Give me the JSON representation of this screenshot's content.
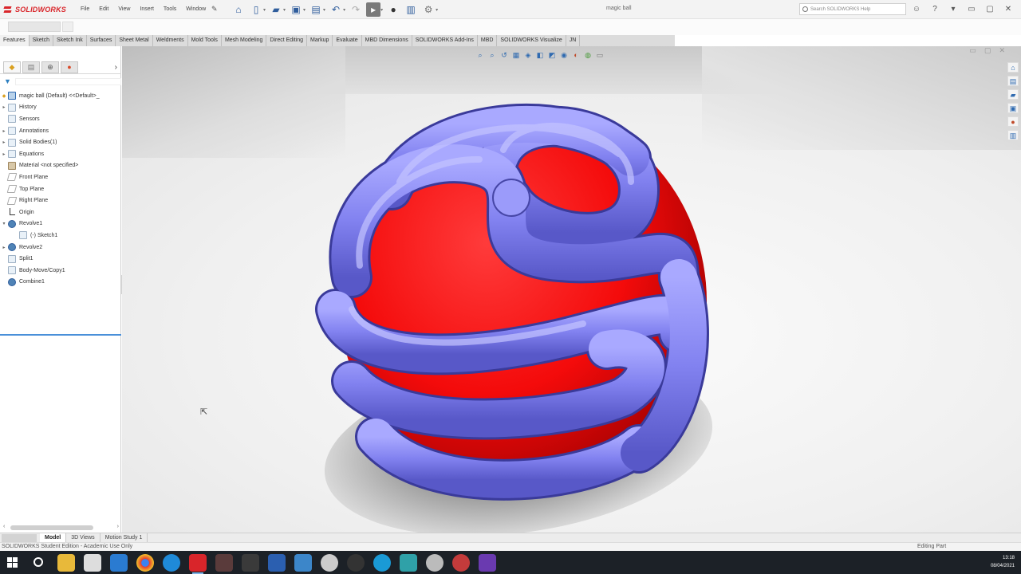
{
  "app": {
    "brand": "SOLIDWORKS",
    "document_title": "magic ball",
    "menu": [
      "File",
      "Edit",
      "View",
      "Insert",
      "Tools",
      "Window"
    ],
    "search_placeholder": "Search SOLIDWORKS Help"
  },
  "tabs": [
    "Features",
    "Sketch",
    "Sketch Ink",
    "Surfaces",
    "Sheet Metal",
    "Weldments",
    "Mold Tools",
    "Mesh Modeling",
    "Direct Editing",
    "Markup",
    "Evaluate",
    "MBD Dimensions",
    "SOLIDWORKS Add-Ins",
    "MBD",
    "SOLIDWORKS Visualize",
    "JN"
  ],
  "feature_tree": {
    "root": "magic ball (Default) <<Default>_",
    "items": [
      {
        "label": "History",
        "expandable": true
      },
      {
        "label": "Sensors",
        "expandable": false
      },
      {
        "label": "Annotations",
        "expandable": true
      },
      {
        "label": "Solid Bodies(1)",
        "expandable": true
      },
      {
        "label": "Equations",
        "expandable": true
      },
      {
        "label": "Material <not specified>",
        "expandable": false
      },
      {
        "label": "Front Plane",
        "expandable": false
      },
      {
        "label": "Top Plane",
        "expandable": false
      },
      {
        "label": "Right Plane",
        "expandable": false
      },
      {
        "label": "Origin",
        "expandable": false
      },
      {
        "label": "Revolve1",
        "expandable": true
      },
      {
        "label": "(-) Sketch1",
        "expandable": false
      },
      {
        "label": "Revolve2",
        "expandable": true
      },
      {
        "label": "Split1",
        "expandable": false
      },
      {
        "label": "Body-Move/Copy1",
        "expandable": false
      },
      {
        "label": "Combine1",
        "expandable": false
      }
    ]
  },
  "bottom_tabs": [
    "Model",
    "3D Views",
    "Motion Study 1"
  ],
  "status": {
    "left": "SOLIDWORKS Student Edition - Academic Use Only",
    "right": "Editing Part"
  },
  "clock": {
    "time": "13:18",
    "date": "08/04/2021"
  },
  "colors": {
    "tube": "#8c8cf2",
    "core": "#ff1010",
    "brand": "#d9252a",
    "accent": "#2f6ab0"
  }
}
